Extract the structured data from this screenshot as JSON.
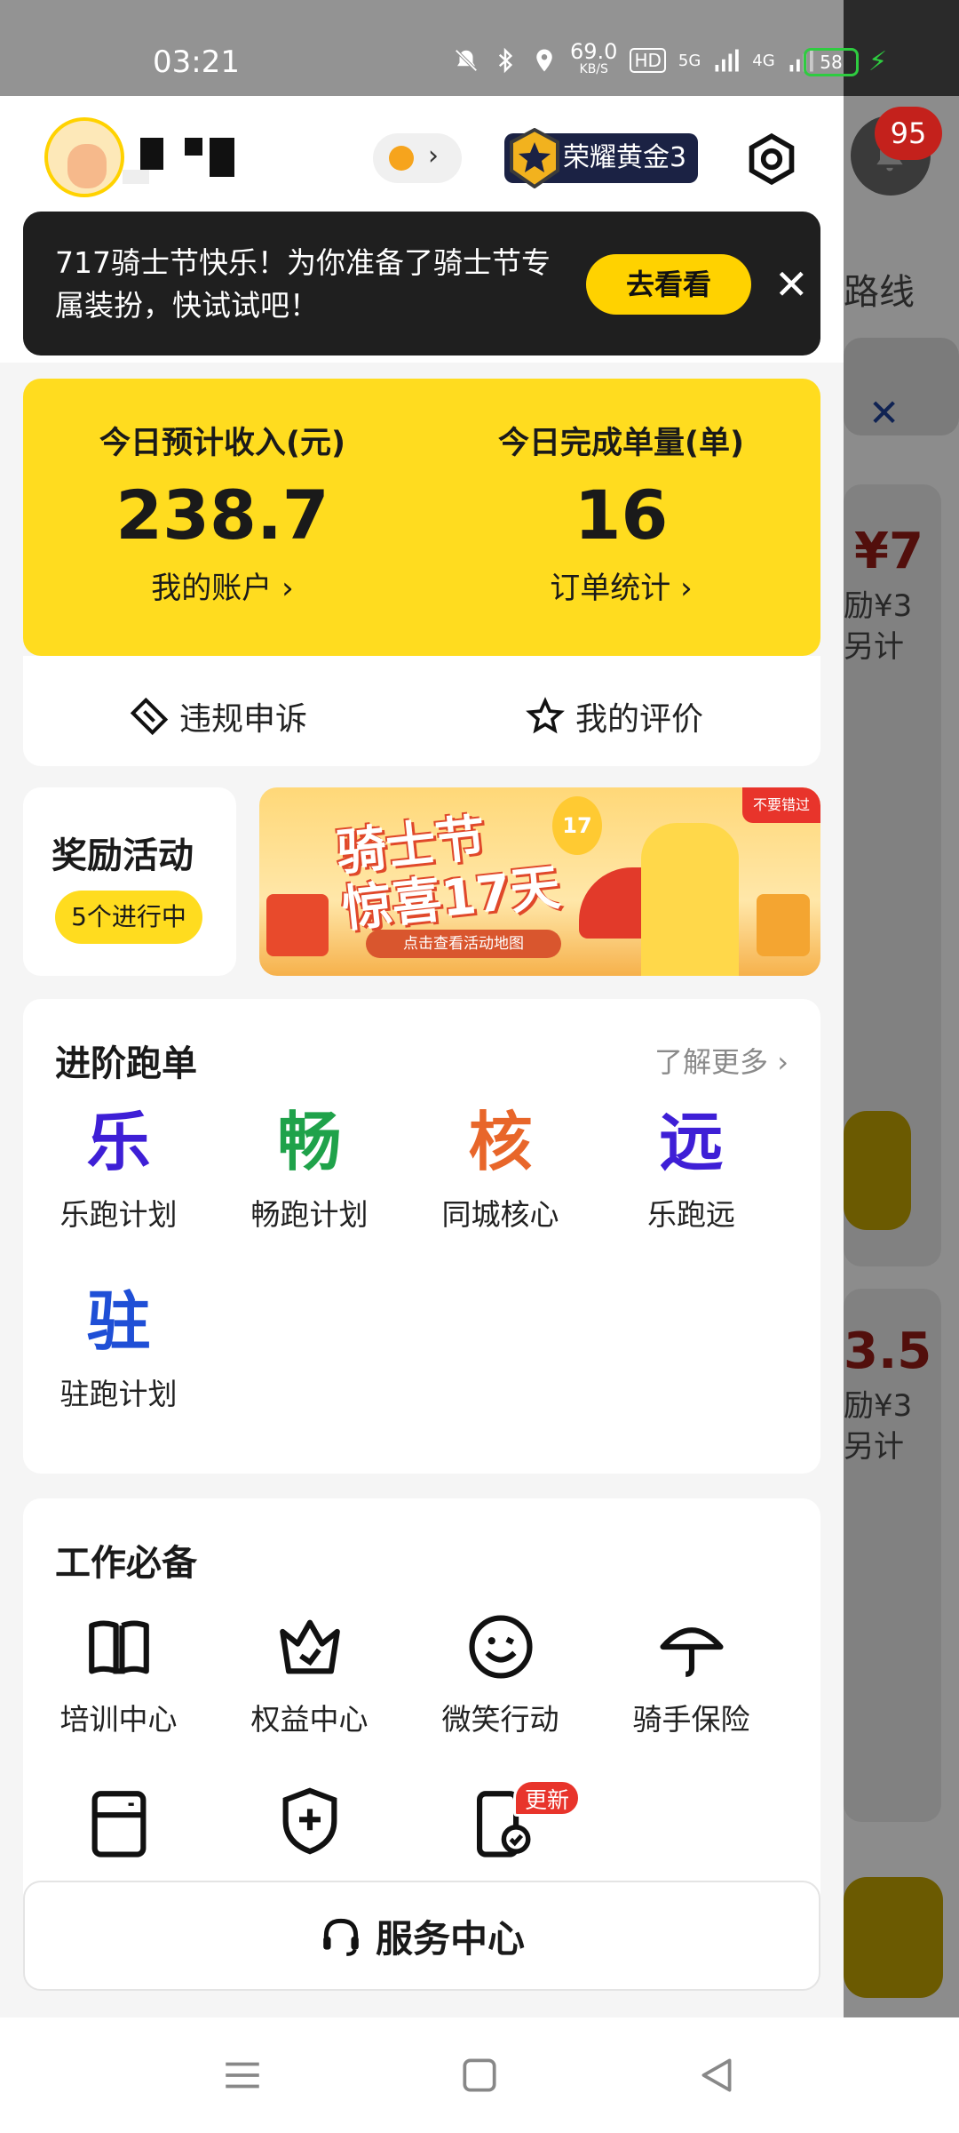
{
  "status_bar": {
    "time": "03:21",
    "network_speed": "69.0",
    "network_speed_unit": "KB/S",
    "hd": "HD",
    "signal_5g": "5G",
    "signal_4g": "4G",
    "battery": "58"
  },
  "background_page": {
    "notification_count": "95",
    "route_fragment": "路线",
    "order1_price": "¥7",
    "order1_line1": "励¥3",
    "order1_line2": "另计",
    "order2_price": "3.5",
    "order2_line1": "励¥3",
    "order2_line2": "另计"
  },
  "header": {
    "rank_label": "荣耀黄金3"
  },
  "notice_banner": {
    "text": "717骑士节快乐！为你准备了骑士节专属装扮，快试试吧！",
    "button": "去看看"
  },
  "stats": {
    "income_label": "今日预计收入(元)",
    "income_value": "238.7",
    "income_link": "我的账户 ›",
    "orders_label": "今日完成单量(单)",
    "orders_value": "16",
    "orders_link": "订单统计 ›",
    "appeal": "违规申诉",
    "rating": "我的评价"
  },
  "rewards": {
    "title": "奖励活动",
    "ongoing": "5个进行中"
  },
  "promo_banner": {
    "tag": "不要错过",
    "headline_line1": "骑士节",
    "headline_line2": "惊喜17天",
    "balloon": "17",
    "subtitle": "点击查看活动地图"
  },
  "advanced": {
    "title": "进阶跑单",
    "more": "了解更多 ›",
    "items": [
      {
        "glyph": "乐",
        "label": "乐跑计划",
        "color": "#3e1fd6"
      },
      {
        "glyph": "畅",
        "label": "畅跑计划",
        "color": "#1fa24a"
      },
      {
        "glyph": "核",
        "label": "同城核心",
        "color": "#e8662a"
      },
      {
        "glyph": "远",
        "label": "乐跑远",
        "color": "#3e1fd6"
      },
      {
        "glyph": "驻",
        "label": "驻跑计划",
        "color": "#1f4fd6"
      }
    ]
  },
  "work": {
    "title": "工作必备",
    "items": [
      {
        "label": "培训中心",
        "icon": "book-icon"
      },
      {
        "label": "权益中心",
        "icon": "crown-icon"
      },
      {
        "label": "微笑行动",
        "icon": "smile-icon"
      },
      {
        "label": "骑手保险",
        "icon": "umbrella-icon"
      }
    ],
    "update_badge": "更新"
  },
  "service": {
    "label": "服务中心"
  }
}
